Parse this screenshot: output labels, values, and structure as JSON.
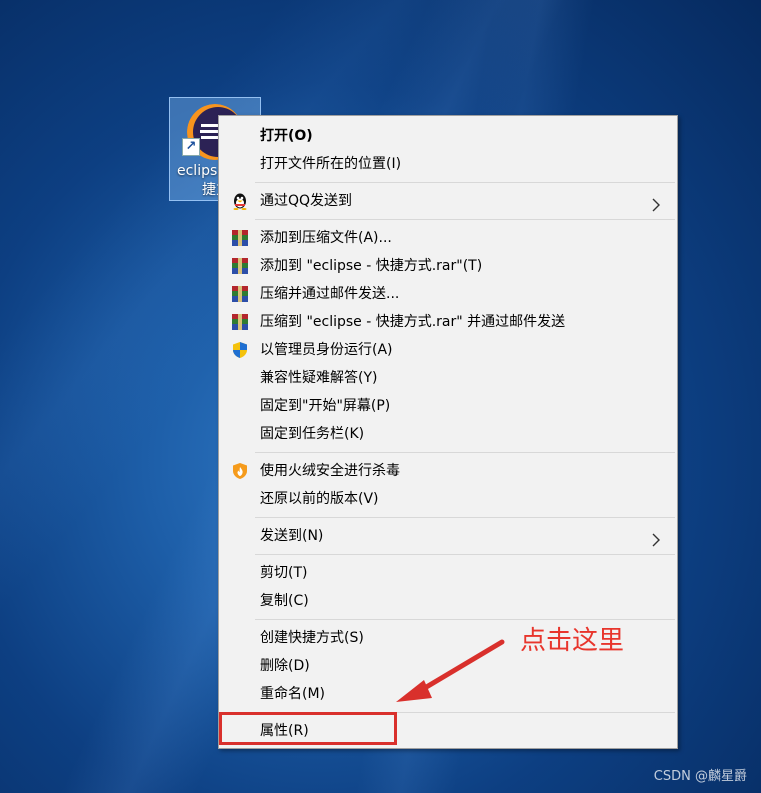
{
  "desktop_icon": {
    "label_line1": "eclips",
    "label_line2": "捷方"
  },
  "menu": {
    "items": [
      {
        "label": "打开(O)",
        "icon": "none"
      },
      {
        "label": "打开文件所在的位置(I)",
        "icon": "none"
      },
      {
        "label": "通过QQ发送到",
        "icon": "qq-penguin-icon",
        "submenu": true
      },
      {
        "label": "添加到压缩文件(A)...",
        "icon": "winrar-icon"
      },
      {
        "label": "添加到 \"eclipse - 快捷方式.rar\"(T)",
        "icon": "winrar-icon"
      },
      {
        "label": "压缩并通过邮件发送...",
        "icon": "winrar-icon"
      },
      {
        "label": "压缩到 \"eclipse - 快捷方式.rar\" 并通过邮件发送",
        "icon": "winrar-icon"
      },
      {
        "label": "以管理员身份运行(A)",
        "icon": "uac-shield-icon"
      },
      {
        "label": "兼容性疑难解答(Y)",
        "icon": "none"
      },
      {
        "label": "固定到\"开始\"屏幕(P)",
        "icon": "none"
      },
      {
        "label": "固定到任务栏(K)",
        "icon": "none"
      },
      {
        "label": "使用火绒安全进行杀毒",
        "icon": "huorong-shield-icon"
      },
      {
        "label": "还原以前的版本(V)",
        "icon": "none"
      },
      {
        "label": "发送到(N)",
        "icon": "none",
        "submenu": true
      },
      {
        "label": "剪切(T)",
        "icon": "none"
      },
      {
        "label": "复制(C)",
        "icon": "none"
      },
      {
        "label": "创建快捷方式(S)",
        "icon": "none"
      },
      {
        "label": "删除(D)",
        "icon": "none"
      },
      {
        "label": "重命名(M)",
        "icon": "none"
      },
      {
        "label": "属性(R)",
        "icon": "none"
      }
    ]
  },
  "annotation": {
    "text": "点击这里",
    "color": "#e8352c"
  },
  "watermark": "CSDN @麟星爵",
  "colors": {
    "menu_bg": "#f2f2f2",
    "highlight_border": "#d9302c"
  }
}
